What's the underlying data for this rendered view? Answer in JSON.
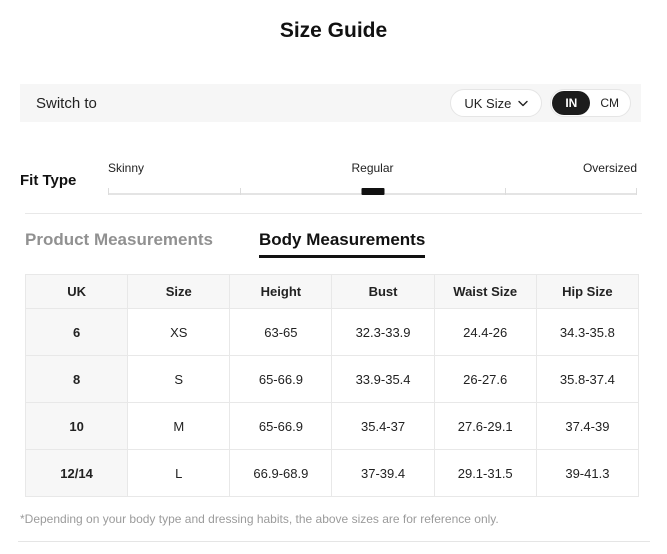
{
  "title": "Size Guide",
  "switch_bar": {
    "label": "Switch to",
    "size_dropdown": {
      "value": "UK Size"
    },
    "unit_toggle": {
      "selected": "IN",
      "options": [
        {
          "label": "IN"
        },
        {
          "label": "CM"
        }
      ]
    }
  },
  "fit_type": {
    "label": "Fit Type",
    "options": [
      "Skinny",
      "Regular",
      "Oversized"
    ],
    "selected": "Regular"
  },
  "tabs": [
    {
      "label": "Product Measurements",
      "active": false
    },
    {
      "label": "Body Measurements",
      "active": true
    }
  ],
  "table": {
    "headers": [
      "UK",
      "Size",
      "Height",
      "Bust",
      "Waist Size",
      "Hip Size"
    ],
    "rows": [
      [
        "6",
        "XS",
        "63-65",
        "32.3-33.9",
        "24.4-26",
        "34.3-35.8"
      ],
      [
        "8",
        "S",
        "65-66.9",
        "33.9-35.4",
        "26-27.6",
        "35.8-37.4"
      ],
      [
        "10",
        "M",
        "65-66.9",
        "35.4-37",
        "27.6-29.1",
        "37.4-39"
      ],
      [
        "12/14",
        "L",
        "66.9-68.9",
        "37-39.4",
        "29.1-31.5",
        "39-41.3"
      ]
    ]
  },
  "footnote": "*Depending on your body type and dressing habits, the above sizes are for reference only.",
  "colors": {
    "text": "#222222",
    "muted_text": "#9b9b9b",
    "inactive_tab": "#919191",
    "bar_background": "#f6f6f6",
    "table_header_background": "#f7f7f7",
    "border": "#e5e5e5",
    "toggle_active_background": "#1c1c1c",
    "accent_black": "#111111"
  }
}
